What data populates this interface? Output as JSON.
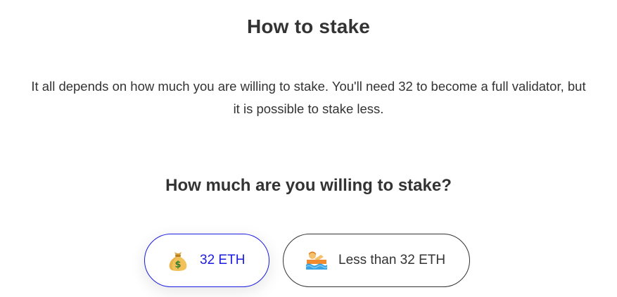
{
  "page": {
    "title": "How to stake",
    "description_line1": "It all depends on how much you are willing to stake. You'll need 32 to become a full validator, but",
    "description_line2": "it is possible to stake less.",
    "question": "How much are you willing to stake?"
  },
  "options": [
    {
      "label": "32 ETH",
      "icon": "money-bag-icon",
      "selected": true
    },
    {
      "label": "Less than 32 ETH",
      "icon": "swimmer-icon",
      "selected": false
    }
  ],
  "colors": {
    "accent": "#1c1ce1",
    "text": "#333333",
    "background": "#ffffff"
  }
}
